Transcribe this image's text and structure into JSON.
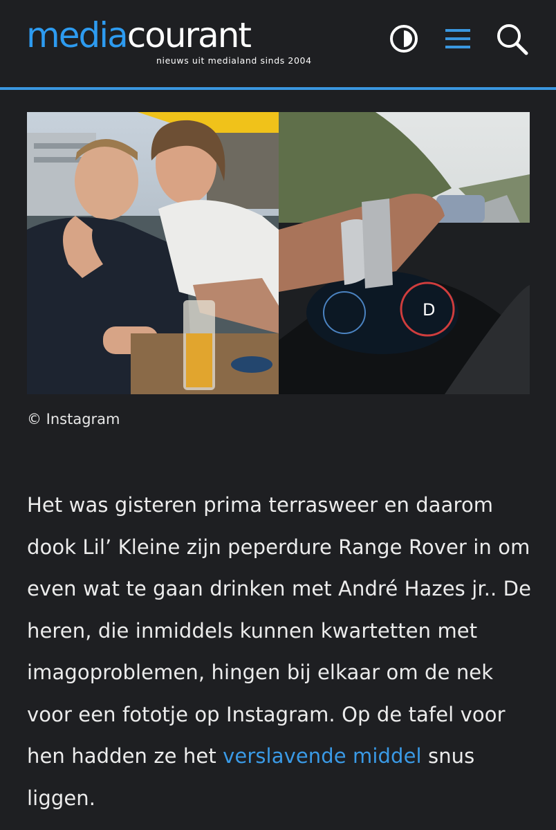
{
  "header": {
    "logo_part1": "media",
    "logo_part2": "courant",
    "tagline": "nieuws uit medialand sinds 2004",
    "icons": [
      "contrast-icon",
      "menu-icon",
      "search-icon"
    ]
  },
  "colors": {
    "background": "#1e1f22",
    "accent": "#2d9bf0",
    "divider": "#3a97e0",
    "link": "#3a9ae6"
  },
  "media": {
    "photos": [
      "terrace-selfie-photo",
      "steering-wheel-watch-photo"
    ],
    "caption": "© Instagram"
  },
  "article": {
    "text_1": "Het was gisteren prima terrasweer en daarom dook Lil’ Kleine zijn peperdure Range Rover in om even wat te gaan drinken met André Hazes jr.. De heren, die inmiddels kunnen kwartetten met imagoproblemen, hingen bij elkaar om de nek voor een fototje op Instagram. Op de tafel voor hen hadden ze het ",
    "link_text": "verslavende middel",
    "text_2": " snus liggen."
  }
}
